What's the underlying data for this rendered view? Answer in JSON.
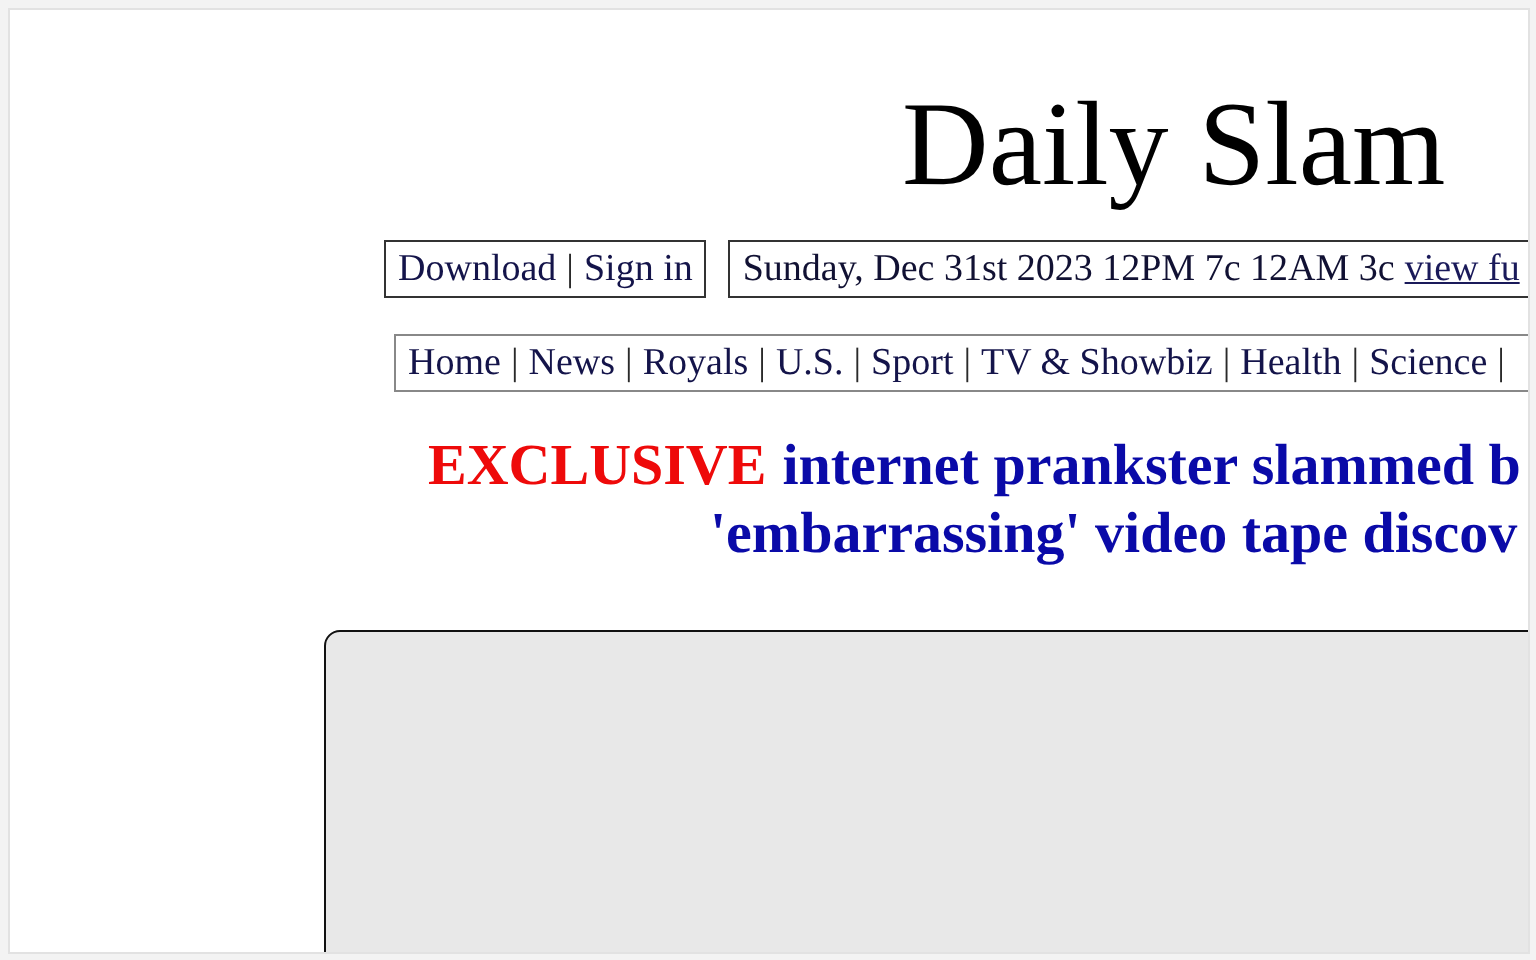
{
  "masthead": {
    "title": "Daily Slam"
  },
  "account_links": [
    {
      "kind": "link",
      "label": "Download"
    },
    {
      "kind": "separator",
      "label": "|"
    },
    {
      "kind": "link",
      "label": "Sign in"
    }
  ],
  "dateline": {
    "text": "Sunday, Dec 31st 2023 12PM 7c 12AM 3c",
    "link": "view fu"
  },
  "nav": [
    {
      "kind": "link",
      "label": "Home"
    },
    {
      "kind": "separator",
      "label": "|"
    },
    {
      "kind": "link",
      "label": "News"
    },
    {
      "kind": "separator",
      "label": "|"
    },
    {
      "kind": "link",
      "label": "Royals"
    },
    {
      "kind": "separator",
      "label": "|"
    },
    {
      "kind": "link",
      "label": "U.S."
    },
    {
      "kind": "separator",
      "label": "|"
    },
    {
      "kind": "link",
      "label": "Sport"
    },
    {
      "kind": "separator",
      "label": "|"
    },
    {
      "kind": "link",
      "label": "TV & Showbiz"
    },
    {
      "kind": "separator",
      "label": "|"
    },
    {
      "kind": "link",
      "label": "Health"
    },
    {
      "kind": "separator",
      "label": "|"
    },
    {
      "kind": "link",
      "label": "Science"
    },
    {
      "kind": "separator",
      "label": "|"
    }
  ],
  "headline": {
    "tag": "EXCLUSIVE",
    "lines": [
      "internet prankster slammed b",
      "'embarrassing' video tape discov"
    ]
  },
  "video_panel": {
    "kind": "empty"
  }
}
